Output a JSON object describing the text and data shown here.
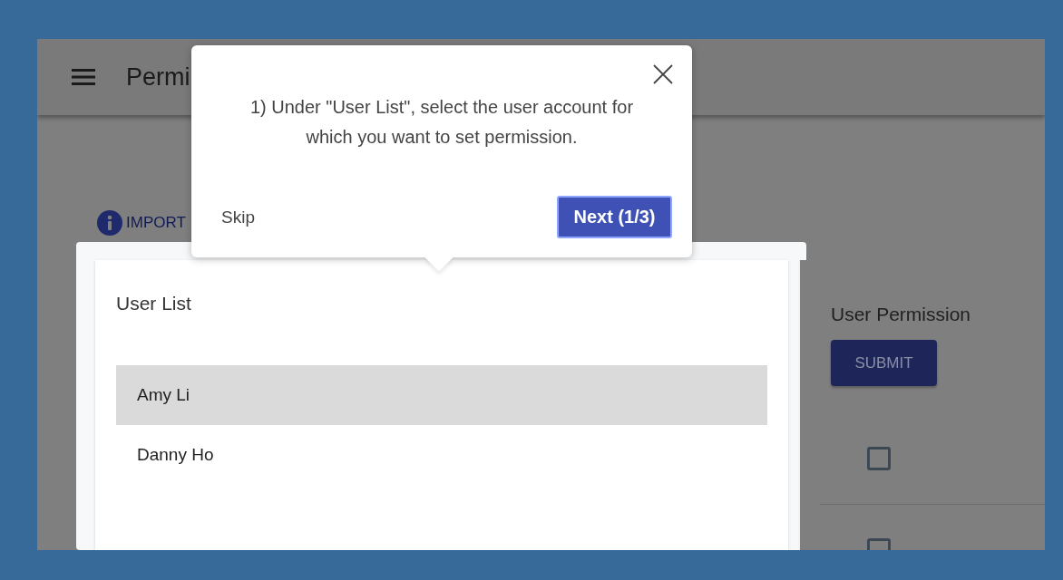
{
  "app_bar": {
    "title": "Permi"
  },
  "notice": {
    "label": "IMPORT"
  },
  "user_list": {
    "title": "User List",
    "users": [
      {
        "name": "Amy Li",
        "selected": true
      },
      {
        "name": "Danny Ho",
        "selected": false
      }
    ]
  },
  "user_permission": {
    "title": "User Permission",
    "submit": "SUBMIT",
    "permissions": [
      {
        "checked": false
      },
      {
        "checked": false
      }
    ]
  },
  "tour_popup": {
    "message": "1) Under \"User List\", select the user account for which you want to set permission.",
    "skip": "Skip",
    "next": "Next (1/3)"
  }
}
